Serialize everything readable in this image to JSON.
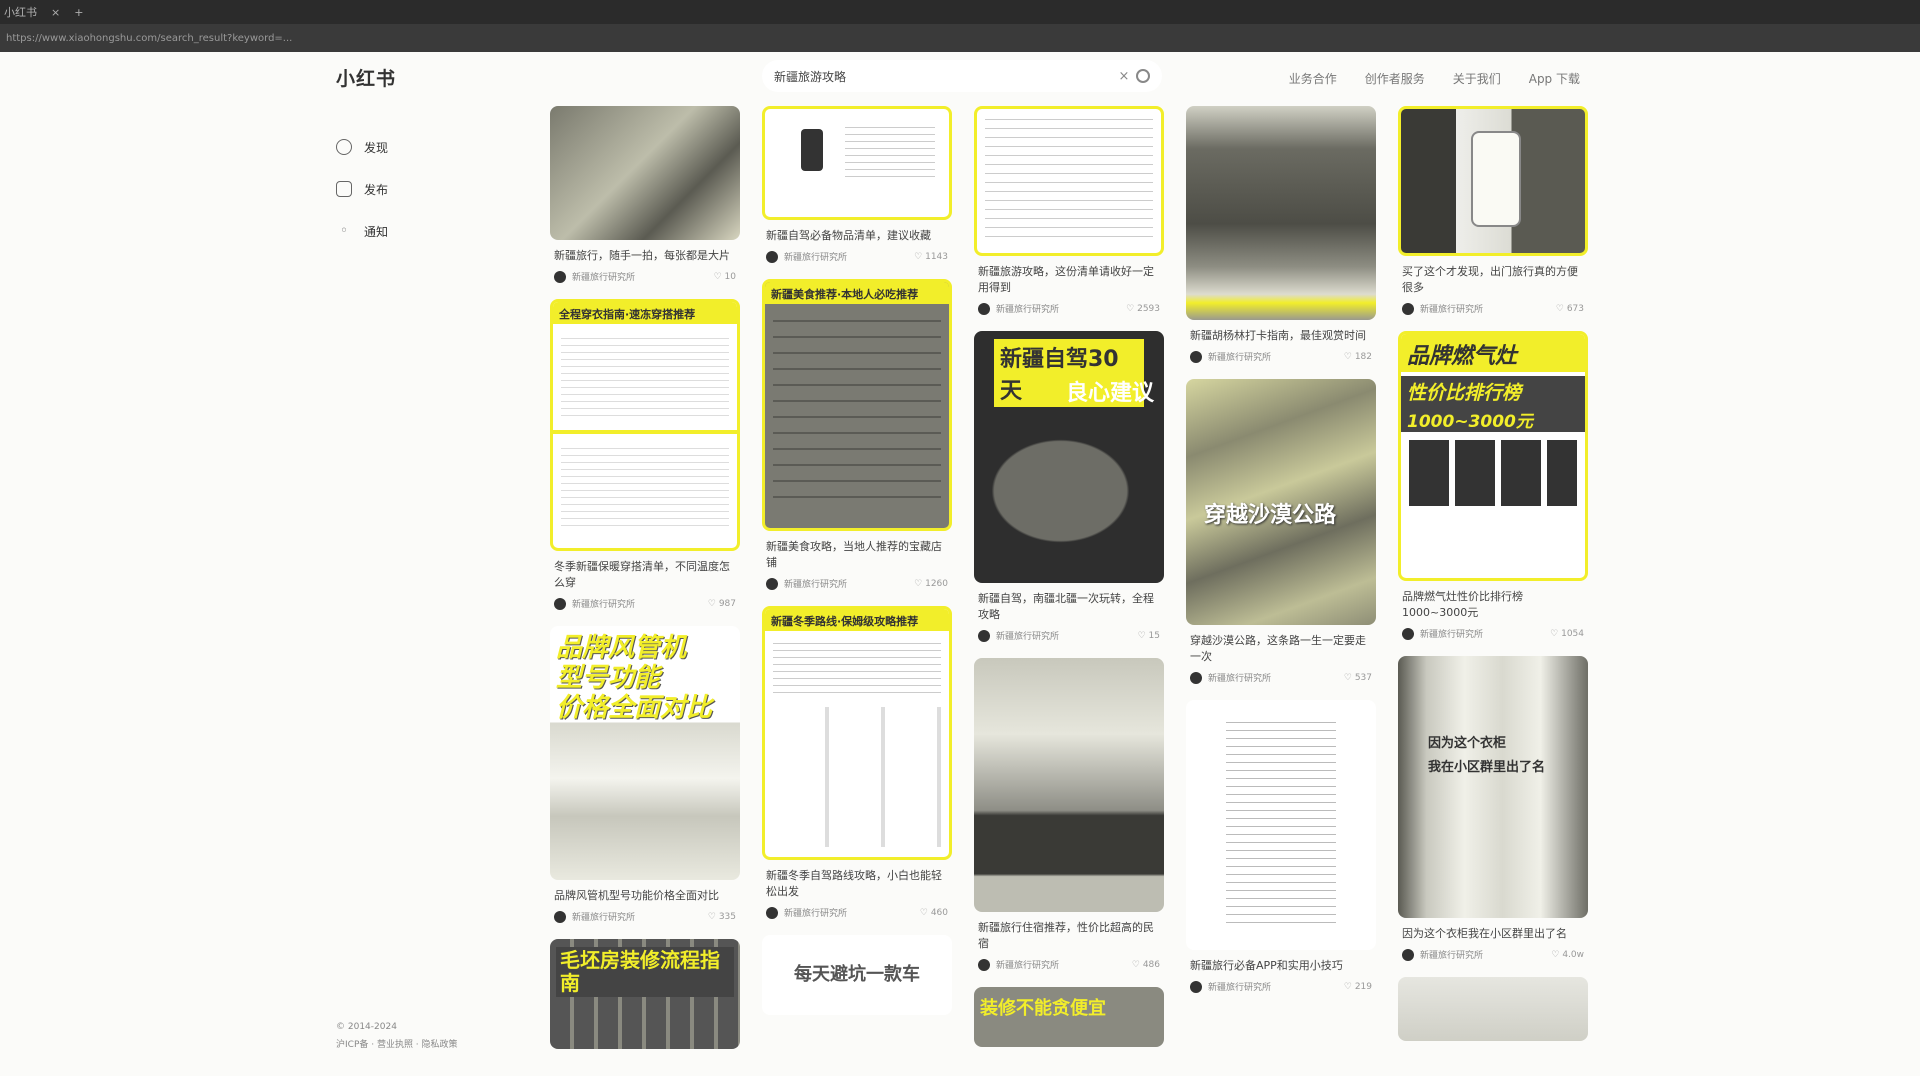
{
  "browser": {
    "tab_label": "小红书",
    "tab_close": "×",
    "tab_new": "+",
    "address": "https://www.xiaohongshu.com/search_result?keyword=..."
  },
  "header": {
    "logo": "小红书",
    "search_value": "新疆旅游攻略",
    "nav": [
      "业务合作",
      "创作者服务",
      "关于我们",
      "App 下载"
    ]
  },
  "sidebar": {
    "items": [
      {
        "label": "发现",
        "icon": "discover-icon"
      },
      {
        "label": "发布",
        "icon": "publish-icon"
      },
      {
        "label": "通知",
        "icon": "notice-icon"
      }
    ],
    "footer1": "© 2014-2024",
    "footer2": "沪ICP备 · 营业执照 · 隐私政策"
  },
  "feed": {
    "col1": [
      {
        "title": "新疆旅行，随手一拍，每张都是大片",
        "author": "新疆旅行研究所",
        "likes": "10",
        "cover": "photo"
      },
      {
        "title": "冬季新疆保暖穿搭清单，不同温度怎么穿",
        "author": "新疆旅行研究所",
        "likes": "987",
        "cover_title": "全程穿衣指南·速冻穿搭推荐"
      },
      {
        "title": "品牌风管机型号功能价格全面对比",
        "author": "新疆旅行研究所",
        "likes": "335",
        "cover_big": [
          "品牌风管机",
          "型号功能",
          "价格全面对比"
        ]
      },
      {
        "title": "",
        "author": "",
        "likes": "",
        "cover_big": [
          "毛坯房装修流程指南"
        ]
      }
    ],
    "col2": [
      {
        "title": "新疆自驾必备物品清单，建议收藏",
        "author": "新疆旅行研究所",
        "likes": "1143",
        "cover": "doc"
      },
      {
        "title": "新疆美食攻略，当地人推荐的宝藏店铺",
        "author": "新疆旅行研究所",
        "likes": "1260",
        "cover_title": "新疆美食推荐·本地人必吃推荐"
      },
      {
        "title": "新疆冬季自驾路线攻略，小白也能轻松出发",
        "author": "新疆旅行研究所",
        "likes": "460",
        "cover_title": "新疆冬季路线·保姆级攻略推荐"
      },
      {
        "title": "",
        "author": "",
        "likes": "",
        "cover_big": [
          "每天避坑一款车"
        ]
      }
    ],
    "col3": [
      {
        "title": "新疆旅游攻略，这份清单请收好一定用得到",
        "author": "新疆旅行研究所",
        "likes": "2593",
        "cover": "table"
      },
      {
        "title": "新疆自驾，南疆北疆一次玩转，全程攻略",
        "author": "新疆旅行研究所",
        "likes": "15",
        "cover_big": [
          "新疆自驾30天",
          "良心建议"
        ]
      },
      {
        "title": "新疆旅行住宿推荐，性价比超高的民宿",
        "author": "新疆旅行研究所",
        "likes": "486",
        "cover": "room"
      },
      {
        "title": "",
        "author": "",
        "likes": "",
        "cover_big": [
          "装修不能贪便宜"
        ]
      }
    ],
    "col4": [
      {
        "title": "新疆胡杨林打卡指南，最佳观赏时间",
        "author": "新疆旅行研究所",
        "likes": "182",
        "cover": "forest"
      },
      {
        "title": "穿越沙漠公路，这条路一生一定要走一次",
        "author": "新疆旅行研究所",
        "likes": "537",
        "cover_big": [
          "穿越沙漠公路"
        ]
      },
      {
        "title": "新疆旅行必备APP和实用小技巧",
        "author": "新疆旅行研究所",
        "likes": "219",
        "cover": "list"
      }
    ],
    "col5": [
      {
        "title": "买了这个才发现，出门旅行真的方便很多",
        "author": "新疆旅行研究所",
        "likes": "673",
        "cover": "device"
      },
      {
        "title": "品牌燃气灶性价比排行榜 1000~3000元",
        "author": "新疆旅行研究所",
        "likes": "1054",
        "cover_big": [
          "品牌燃气灶",
          "性价比排行榜",
          "1000~3000元"
        ]
      },
      {
        "title": "因为这个衣柜我在小区群里出了名",
        "author": "新疆旅行研究所",
        "likes": "4.0w",
        "cover_big": [
          "因为这个衣柜",
          "我在小区群里出了名"
        ]
      },
      {
        "title": "",
        "author": "",
        "likes": "",
        "cover": "plain"
      }
    ]
  },
  "colors": {
    "accent": "#f2ee2a",
    "dark": "#2b2b2b"
  }
}
